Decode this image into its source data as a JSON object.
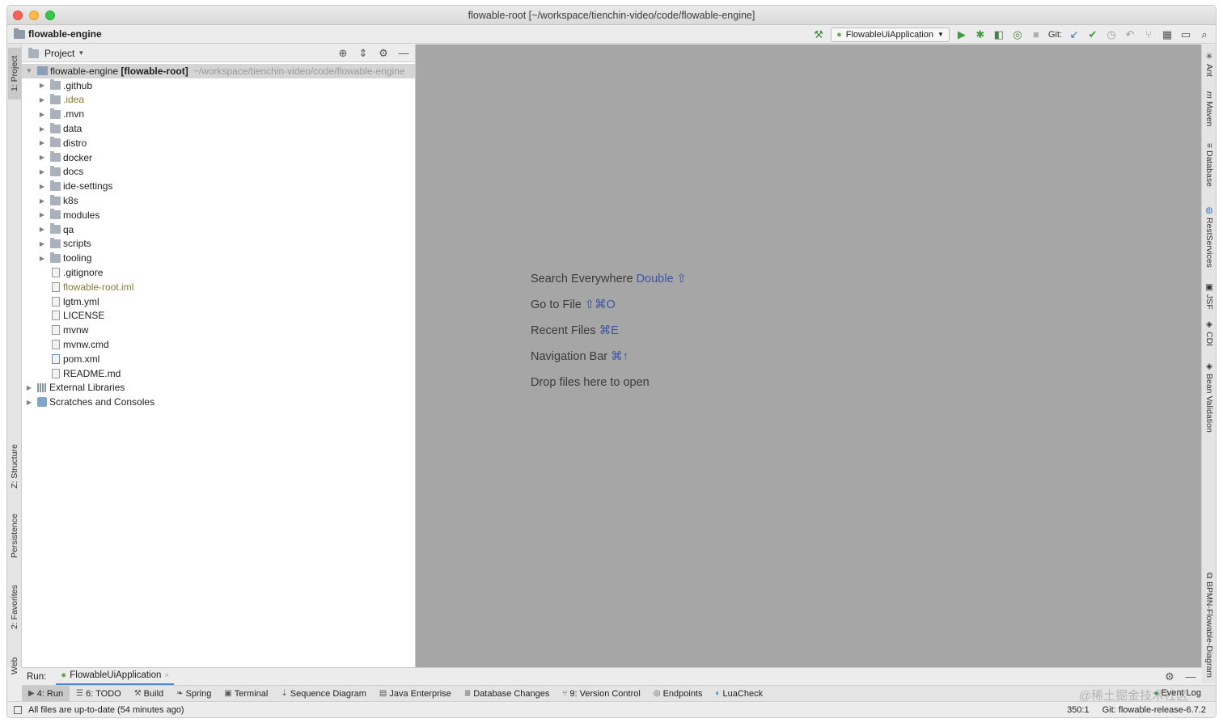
{
  "window": {
    "title": "flowable-root [~/workspace/tienchin-video/code/flowable-engine]"
  },
  "navbar": {
    "project": "flowable-engine",
    "run_config": "FlowableUiApplication",
    "git_label": "Git:"
  },
  "left_strip": {
    "project": "1: Project",
    "structure": "Z: Structure",
    "persistence": "Persistence",
    "favorites": "2: Favorites",
    "web": "Web"
  },
  "right_strip": {
    "ant": "Ant",
    "maven": "Maven",
    "database": "Database",
    "rest": "RestServices",
    "jsf": "JSF",
    "cdi": "CDI",
    "bean": "Bean Validation",
    "bpmn": "BPMN-Flowable-Diagram"
  },
  "project_panel": {
    "title": "Project",
    "root_name": "flowable-engine",
    "root_bold": "[flowable-root]",
    "root_path": "~/workspace/tienchin-video/code/flowable-engine",
    "folders": [
      ".github",
      ".idea",
      ".mvn",
      "data",
      "distro",
      "docker",
      "docs",
      "ide-settings",
      "k8s",
      "modules",
      "qa",
      "scripts",
      "tooling"
    ],
    "files": [
      ".gitignore",
      "flowable-root.iml",
      "lgtm.yml",
      "LICENSE",
      "mvnw",
      "mvnw.cmd",
      "pom.xml",
      "README.md"
    ],
    "external_libraries": "External Libraries",
    "scratches": "Scratches and Consoles"
  },
  "editor": {
    "hints": [
      {
        "text": "Search Everywhere",
        "key": "Double ⇧"
      },
      {
        "text": "Go to File",
        "key": "⇧⌘O"
      },
      {
        "text": "Recent Files",
        "key": "⌘E"
      },
      {
        "text": "Navigation Bar",
        "key": "⌘↑"
      },
      {
        "text": "Drop files here to open",
        "key": ""
      }
    ]
  },
  "run_panel": {
    "label": "Run:",
    "tab": "FlowableUiApplication"
  },
  "bottom_tabs": {
    "run": "4: Run",
    "todo": "6: TODO",
    "build": "Build",
    "spring": "Spring",
    "terminal": "Terminal",
    "sequence": "Sequence Diagram",
    "java_ee": "Java Enterprise",
    "db_changes": "Database Changes",
    "vcs": "9: Version Control",
    "endpoints": "Endpoints",
    "luacheck": "LuaCheck",
    "event_log": "Event Log"
  },
  "status_bar": {
    "message": "All files are up-to-date (54 minutes ago)",
    "position": "350:1",
    "git": "Git: flowable-release-6.7.2"
  },
  "watermark": "@稀土掘金技术社区",
  "colors": {
    "accent": "#3b54a4",
    "selection": "#d5d5d5",
    "editor_bg": "#a6a6a6"
  }
}
